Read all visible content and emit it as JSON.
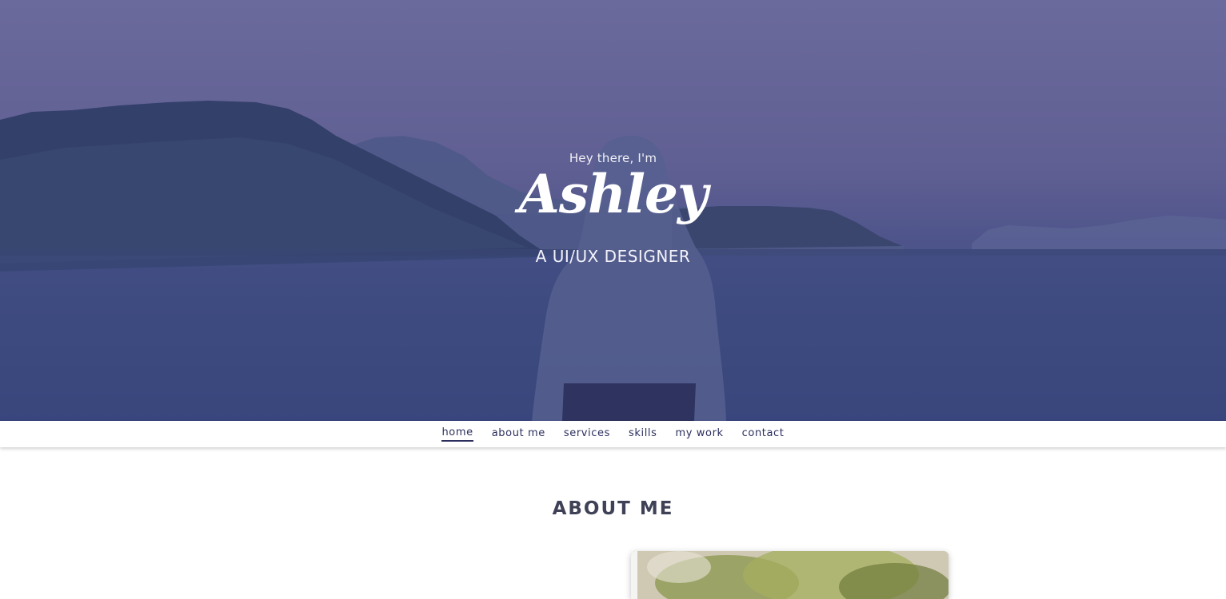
{
  "hero": {
    "greeting": "Hey there, I'm",
    "name": "Ashley",
    "role": "A UI/UX DESIGNER"
  },
  "nav": {
    "items": [
      {
        "label": "home",
        "active": true
      },
      {
        "label": "about me",
        "active": false
      },
      {
        "label": "services",
        "active": false
      },
      {
        "label": "skills",
        "active": false
      },
      {
        "label": "my work",
        "active": false
      },
      {
        "label": "contact",
        "active": false
      }
    ]
  },
  "about": {
    "title": "ABOUT ME"
  },
  "colors": {
    "overlay": "#4d548a",
    "nav_text": "#2c2f5e",
    "title_text": "#3f4256"
  }
}
